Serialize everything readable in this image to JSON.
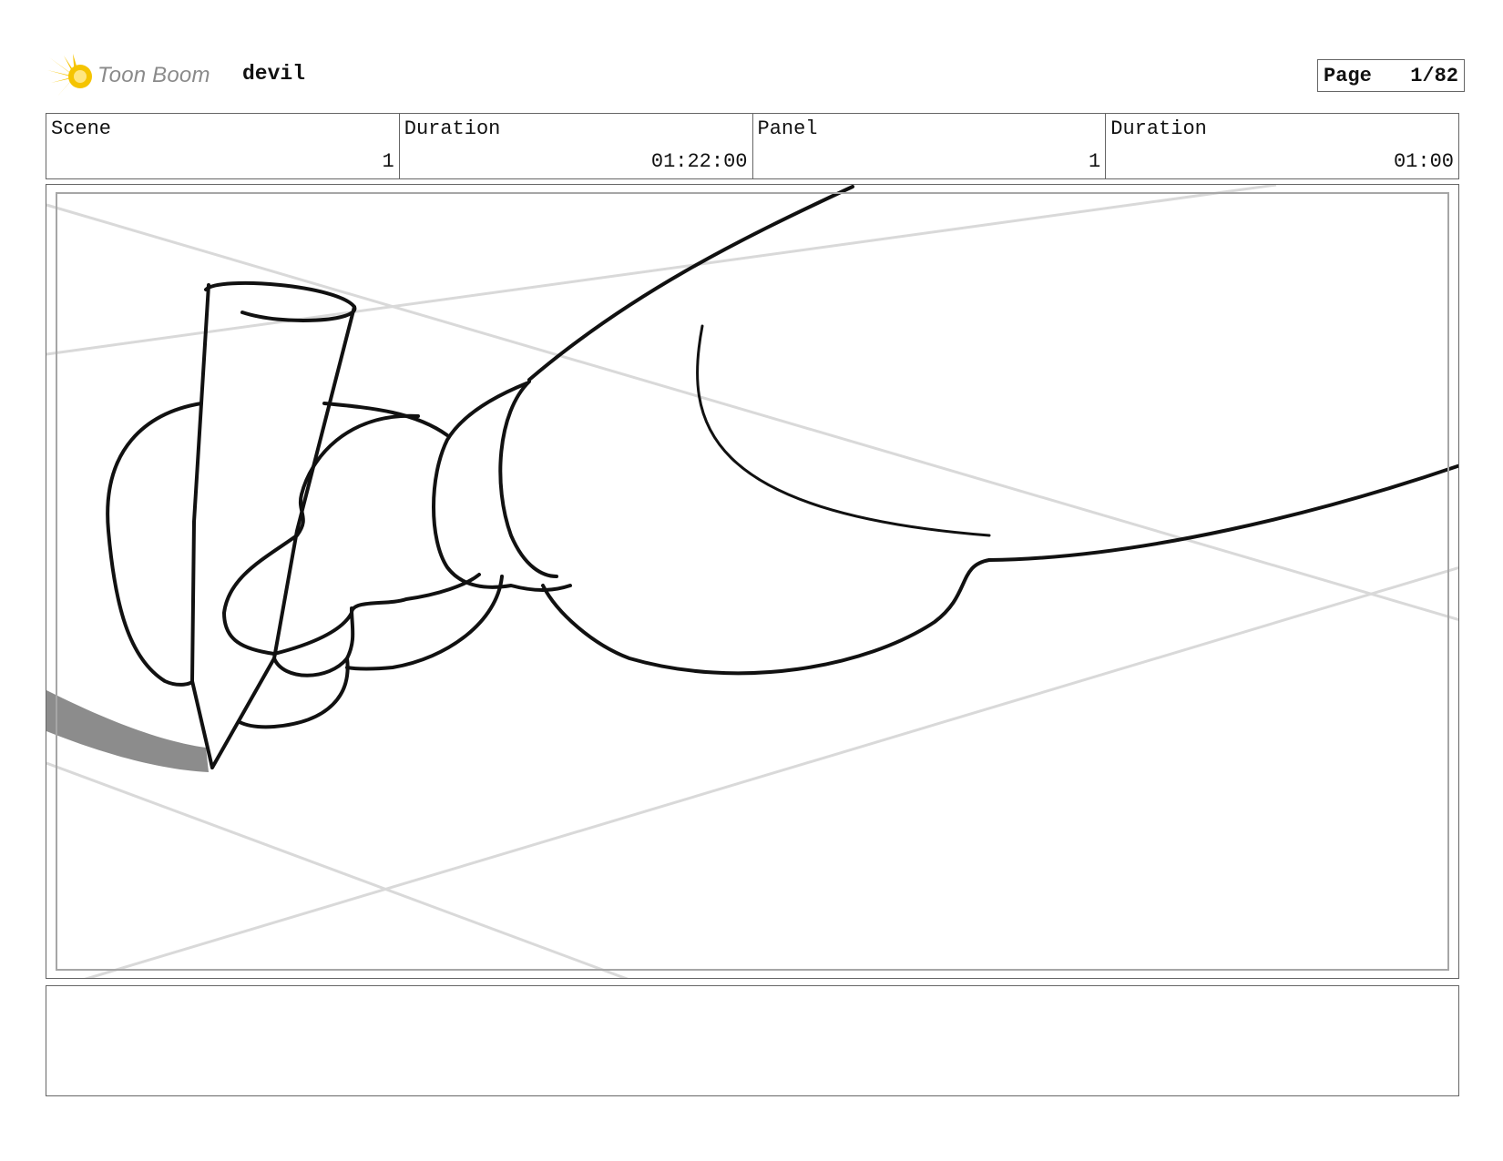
{
  "header": {
    "brand": "Toon Boom",
    "project": "devil",
    "page_label": "Page",
    "page_value": "1/82"
  },
  "info": {
    "scene_label": "Scene",
    "scene_value": "1",
    "scene_duration_label": "Duration",
    "scene_duration_value": "01:22:00",
    "panel_label": "Panel",
    "panel_value": "1",
    "panel_duration_label": "Duration",
    "panel_duration_value": "01:00"
  },
  "notes": {
    "text": ""
  },
  "icons": {
    "logo": "toon-boom-star-icon",
    "logo_color": "#f5c400"
  }
}
